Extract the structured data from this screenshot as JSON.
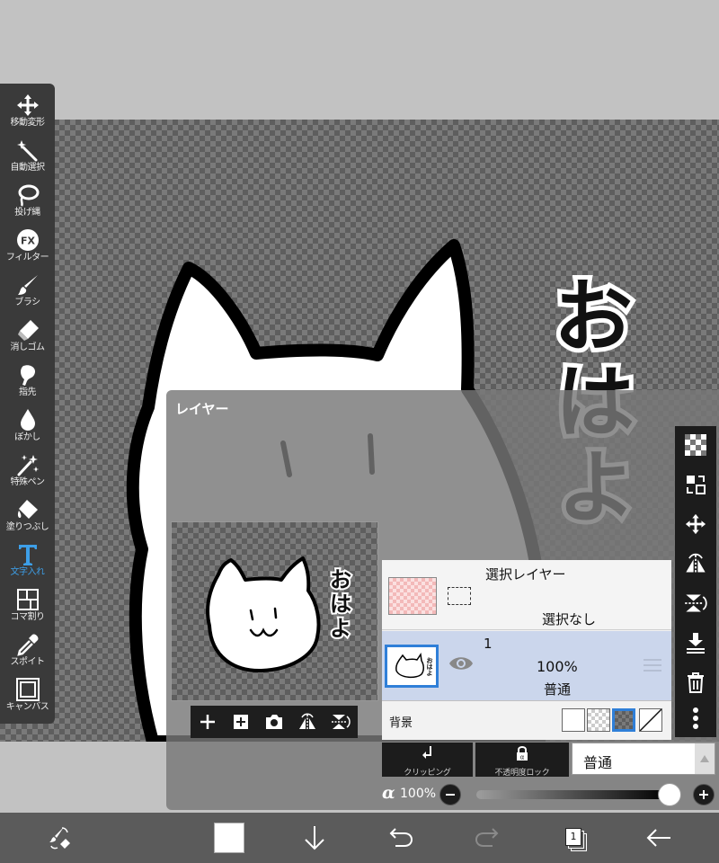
{
  "canvas": {
    "text": [
      "お",
      "は",
      "よ"
    ]
  },
  "toolbar": {
    "tools": [
      {
        "label": "移動変形",
        "icon": "move-icon"
      },
      {
        "label": "自動選択",
        "icon": "magic-wand-icon"
      },
      {
        "label": "投げ縄",
        "icon": "lasso-icon"
      },
      {
        "label": "フィルター",
        "icon": "fx-icon"
      },
      {
        "label": "ブラシ",
        "icon": "brush-icon"
      },
      {
        "label": "消しゴム",
        "icon": "eraser-icon"
      },
      {
        "label": "指先",
        "icon": "smudge-icon"
      },
      {
        "label": "ぼかし",
        "icon": "blur-drop-icon"
      },
      {
        "label": "特殊ペン",
        "icon": "special-pen-icon"
      },
      {
        "label": "塗りつぶし",
        "icon": "fill-bucket-icon"
      },
      {
        "label": "文字入れ",
        "icon": "text-icon",
        "active": true
      },
      {
        "label": "コマ割り",
        "icon": "frame-divider-icon"
      },
      {
        "label": "スポイト",
        "icon": "eyedropper-icon"
      },
      {
        "label": "キャンバス",
        "icon": "canvas-icon"
      }
    ],
    "active_color": "#3d9fe8"
  },
  "layer_panel": {
    "title": "レイヤー",
    "selection_layer": {
      "title": "選択レイヤー",
      "state": "選択なし"
    },
    "layer1": {
      "number": "1",
      "opacity": "100%",
      "blend_mode": "普通"
    },
    "background": {
      "label": "背景"
    },
    "clipping_label": "クリッピング",
    "alpha_lock_label": "不透明度ロック",
    "blend_select_value": "普通",
    "opacity": {
      "symbol": "α",
      "value": "100%",
      "level": 1.0
    },
    "highlight_color": "#2f7fd8"
  },
  "bottom_bar": {
    "layer_count": "1"
  }
}
